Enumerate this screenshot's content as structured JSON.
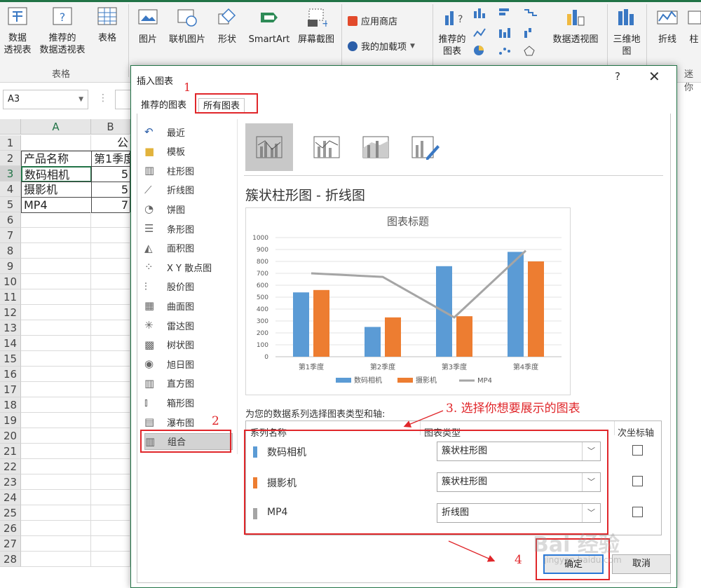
{
  "ribbon": {
    "pivot_table": "数据\n透视表",
    "recommended_pivot": "推荐的\n数据透视表",
    "table": "表格",
    "group_tables": "表格",
    "picture": "图片",
    "online_picture": "联机图片",
    "shapes": "形状",
    "smartart": "SmartArt",
    "screenshot": "屏幕截图",
    "app_store": "应用商店",
    "my_addins": "我的加载项",
    "recommended_charts": "推荐的\n图表",
    "pivot_chart": "数据透视图",
    "map_3d": "三维地\n图",
    "sparkline_line": "折线",
    "sparkline_col": "柱",
    "group_sparklines": "迷你"
  },
  "sheet": {
    "name_box": "A3",
    "columns": [
      "A",
      "B"
    ],
    "rows": [
      "1",
      "2",
      "3",
      "4",
      "5",
      "6",
      "7",
      "8",
      "9",
      "10",
      "11",
      "12",
      "13",
      "14",
      "15",
      "16",
      "17",
      "18",
      "19",
      "20",
      "21",
      "22",
      "23",
      "24",
      "25",
      "26",
      "27",
      "28"
    ],
    "b1_text": "公",
    "header_row": [
      "产品名称",
      "第1季度"
    ],
    "data_rows": [
      {
        "name": "数码相机",
        "q1": "5"
      },
      {
        "name": "摄影机",
        "q1": "5"
      },
      {
        "name": "MP4",
        "q1": "7"
      }
    ]
  },
  "dialog": {
    "title": "插入图表",
    "help": "?",
    "close": "✕",
    "tab_recommended": "推荐的图表",
    "tab_all": "所有图表",
    "left_list": [
      "最近",
      "模板",
      "柱形图",
      "折线图",
      "饼图",
      "条形图",
      "面积图",
      "X Y 散点图",
      "股价图",
      "曲面图",
      "雷达图",
      "树状图",
      "旭日图",
      "直方图",
      "箱形图",
      "瀑布图",
      "组合"
    ],
    "selected_type": "组合",
    "chart_type_title": "簇状柱形图 - 折线图",
    "series_caption": "为您的数据系列选择图表类型和轴:",
    "table_headers": {
      "name": "系列名称",
      "type": "图表类型",
      "secondary": "次坐标轴"
    },
    "series": [
      {
        "name": "数码相机",
        "type": "簇状柱形图",
        "color": "#5b9bd5"
      },
      {
        "name": "摄影机",
        "type": "簇状柱形图",
        "color": "#ed7d31"
      },
      {
        "name": "MP4",
        "type": "折线图",
        "color": "#a5a5a5"
      }
    ],
    "ok": "确定",
    "cancel": "取消"
  },
  "annotations": {
    "step1": "1",
    "step2": "2",
    "step3": "3. 选择你想要展示的图表",
    "step4": "4",
    "color": "#e0262a"
  },
  "watermark": {
    "main": "Bai 经验",
    "sub": "jingyan.baidu.com"
  },
  "chart_data": {
    "type": "bar",
    "title": "图表标题",
    "categories": [
      "第1季度",
      "第2季度",
      "第3季度",
      "第4季度"
    ],
    "series": [
      {
        "name": "数码相机",
        "type": "bar",
        "color": "#5b9bd5",
        "values": [
          540,
          250,
          760,
          880
        ]
      },
      {
        "name": "摄影机",
        "type": "bar",
        "color": "#ed7d31",
        "values": [
          560,
          330,
          340,
          800
        ]
      },
      {
        "name": "MP4",
        "type": "line",
        "color": "#a5a5a5",
        "values": [
          700,
          670,
          330,
          890
        ]
      }
    ],
    "y_ticks": [
      "0",
      "100",
      "200",
      "300",
      "400",
      "500",
      "600",
      "700",
      "800",
      "900",
      "1000"
    ],
    "ylim": [
      0,
      1000
    ],
    "grid": true,
    "legend_position": "bottom"
  }
}
